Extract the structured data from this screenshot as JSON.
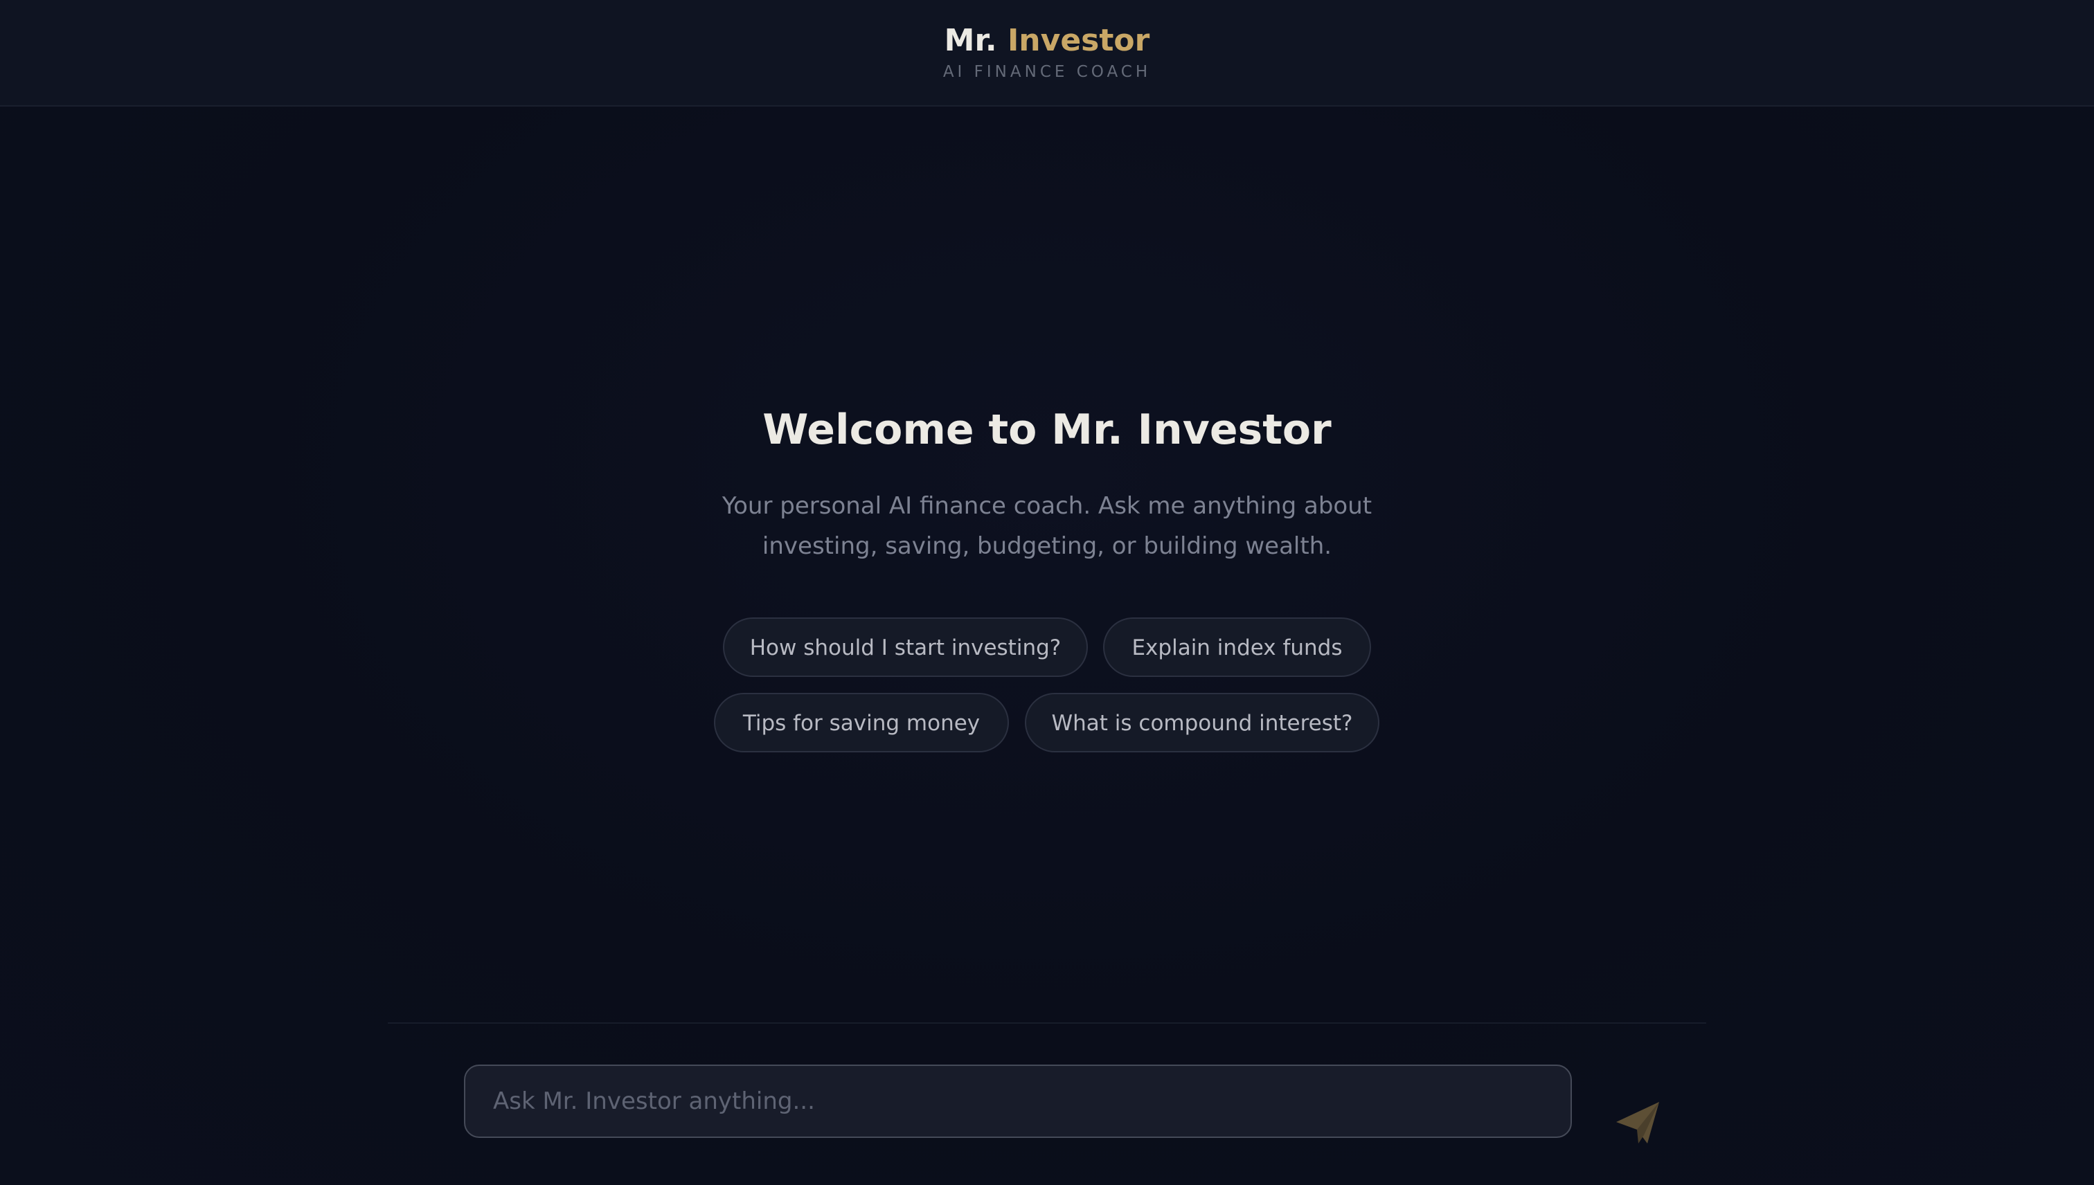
{
  "header": {
    "brand_prefix": "Mr.",
    "brand_accent": "Investor",
    "tagline": "AI FINANCE COACH"
  },
  "welcome": {
    "title": "Welcome to Mr. Investor",
    "description": "Your personal AI finance coach. Ask me anything about investing, saving, budgeting, or building wealth."
  },
  "suggestions": [
    {
      "label": "How should I start investing?"
    },
    {
      "label": "Explain index funds"
    },
    {
      "label": "Tips for saving money"
    },
    {
      "label": "What is compound interest?"
    }
  ],
  "composer": {
    "placeholder": "Ask Mr. Investor anything...",
    "value": "",
    "send_icon": "paper-plane-icon"
  },
  "colors": {
    "accent": "#c9a766",
    "background": "#0a0d1a",
    "header_background": "#0f1422",
    "text_primary": "#eceae4",
    "text_muted": "#7d8292",
    "chip_background": "#151a27",
    "send_icon": "#5d4f35"
  }
}
